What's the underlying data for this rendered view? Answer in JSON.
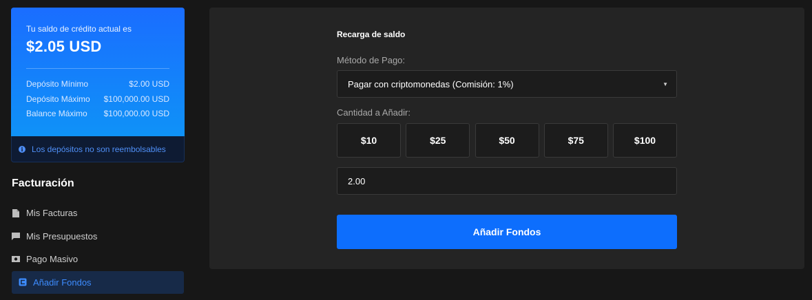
{
  "balance": {
    "caption": "Tu saldo de crédito actual es",
    "amount": "$2.05 USD",
    "limits": [
      {
        "label": "Depósito Mínimo",
        "value": "$2.00 USD"
      },
      {
        "label": "Depósito Máximo",
        "value": "$100,000.00 USD"
      },
      {
        "label": "Balance Máximo",
        "value": "$100,000.00 USD"
      }
    ],
    "note": "Los depósitos no son reembolsables",
    "gradient_start": "#1a6dff",
    "gradient_end": "#0f92f7"
  },
  "sidebar": {
    "heading": "Facturación",
    "items": [
      {
        "label": "Mis Facturas",
        "icon": "document-icon"
      },
      {
        "label": "Mis Presupuestos",
        "icon": "comment-icon"
      },
      {
        "label": "Pago Masivo",
        "icon": "money-icon"
      },
      {
        "label": "Añadir Fondos",
        "icon": "add-funds-icon",
        "active": true
      }
    ],
    "active_color": "#3d8cff"
  },
  "form": {
    "title": "Recarga de saldo",
    "method_label": "Método de Pago:",
    "method_value": "Pagar con criptomonedas (Comisión: 1%)",
    "amount_label": "Cantidad a Añadir:",
    "presets": [
      "$10",
      "$25",
      "$50",
      "$75",
      "$100"
    ],
    "amount_value": "2.00",
    "submit_label": "Añadir Fondos",
    "accent_color": "#0d6efd"
  }
}
